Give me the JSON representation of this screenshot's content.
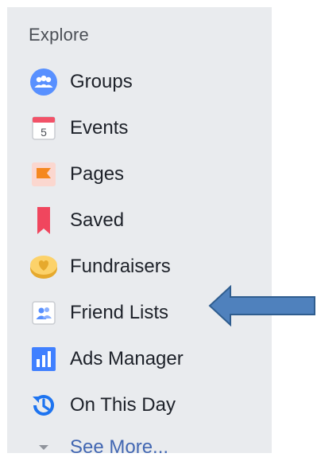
{
  "sidebar": {
    "heading": "Explore",
    "items": [
      {
        "label": "Groups",
        "icon": "groups-icon"
      },
      {
        "label": "Events",
        "icon": "calendar-icon",
        "badge": "5"
      },
      {
        "label": "Pages",
        "icon": "flag-icon"
      },
      {
        "label": "Saved",
        "icon": "bookmark-icon"
      },
      {
        "label": "Fundraisers",
        "icon": "heart-coin-icon"
      },
      {
        "label": "Friend Lists",
        "icon": "friends-icon"
      },
      {
        "label": "Ads Manager",
        "icon": "bar-chart-icon"
      },
      {
        "label": "On This Day",
        "icon": "history-clock-icon"
      }
    ],
    "see_more": "See More..."
  },
  "annotation": {
    "arrow_target": "Friend Lists",
    "arrow_color": "#4f81bd"
  },
  "colors": {
    "panel": "#e9ebee",
    "text": "#1d2129",
    "link": "#4267b2"
  }
}
